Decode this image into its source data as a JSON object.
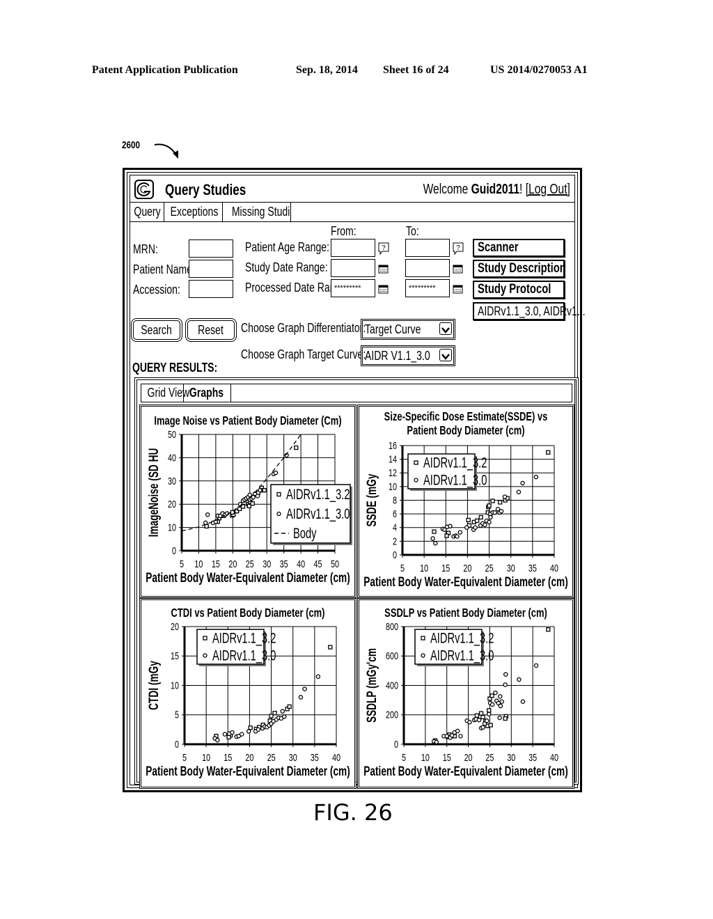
{
  "header": {
    "publication": "Patent Application Publication",
    "date": "Sep. 18, 2014",
    "sheet": "Sheet 16 of 24",
    "number": "US 2014/0270053 A1"
  },
  "reference_label": "2600",
  "figure_caption": "FIG. 26",
  "app": {
    "title": "Query Studies",
    "welcome_prefix": "Welcome ",
    "username": "Guid2011",
    "welcome_suffix": "! ",
    "logout": "[Log Out]"
  },
  "nav_tabs": [
    {
      "label": "Query"
    },
    {
      "label": "Exceptions"
    },
    {
      "label": "Missing Studies"
    }
  ],
  "form": {
    "from_label": "From:",
    "to_label": "To:",
    "mrn_label": "MRN:",
    "mrn_value": "",
    "patient_name_label": "Patient Name:",
    "patient_name_value": "",
    "accession_label": "Accession:",
    "accession_value": "",
    "age_range_label": "Patient Age Range:",
    "age_from": "",
    "age_to": "",
    "study_date_label": "Study Date Range:",
    "study_from": "",
    "study_to": "",
    "processed_date_label": "Processed Date Range:",
    "processed_from": "*********",
    "processed_to": "*********",
    "filter_buttons": [
      "Scanner",
      "Study Description",
      "Study Protocol"
    ],
    "protocol_selection": "AIDRv1.1_3.0, AIDRv1...",
    "search_button": "Search",
    "reset_button": "Reset",
    "differentiator_label": "Choose Graph Differentiator:",
    "differentiator_value": "Target Curve",
    "target_curve_label": "Choose Graph Target Curve:",
    "target_curve_value": "AIDR V1.1_3.0"
  },
  "results": {
    "heading": "QUERY RESULTS:",
    "tabs": [
      {
        "label": "Grid View"
      },
      {
        "label": "Graphs",
        "active": true
      }
    ]
  },
  "chart_data": [
    {
      "type": "scatter",
      "title": "Image Noise vs Patient Body Diameter (Cm)",
      "xlabel": "Patient Body Water-Equivalent Diameter (cm)",
      "ylabel": "ImageNoise (SD HU",
      "xlim": [
        5,
        50
      ],
      "ylim": [
        0,
        50
      ],
      "xticks": [
        5,
        10,
        15,
        20,
        25,
        30,
        35,
        40,
        45,
        50
      ],
      "yticks": [
        0,
        10,
        20,
        30,
        40,
        50
      ],
      "grid": true,
      "legend": "bottom-right",
      "series": [
        {
          "name": "AIDRv1.1_3.2",
          "marker": "square",
          "points": [
            [
              12.3,
              10.5
            ],
            [
              15.6,
              12.5
            ],
            [
              16,
              14
            ],
            [
              17.3,
              15
            ],
            [
              19.8,
              15.2
            ],
            [
              20.2,
              15.5
            ],
            [
              19.9,
              16.5
            ],
            [
              21.2,
              17
            ],
            [
              22,
              18
            ],
            [
              23,
              19
            ],
            [
              24.5,
              20
            ],
            [
              24.8,
              19.2
            ],
            [
              25.1,
              21
            ],
            [
              25.8,
              20.3
            ],
            [
              27.5,
              25
            ],
            [
              28.5,
              27
            ],
            [
              28.8,
              26
            ],
            [
              29.3,
              26
            ],
            [
              38.6,
              44.3
            ]
          ]
        },
        {
          "name": "AIDRv1.1_3.0",
          "marker": "circle",
          "points": [
            [
              12,
              12
            ],
            [
              12.6,
              15.5
            ],
            [
              14.2,
              12
            ],
            [
              15,
              12.5
            ],
            [
              15.6,
              15
            ],
            [
              16.3,
              15
            ],
            [
              17,
              16
            ],
            [
              17.8,
              15.5
            ],
            [
              18.3,
              16
            ],
            [
              22.2,
              20
            ],
            [
              23,
              21.5
            ],
            [
              23.5,
              22
            ],
            [
              24,
              22.5
            ],
            [
              24.5,
              23
            ],
            [
              25,
              24
            ],
            [
              25,
              22
            ],
            [
              25.5,
              22.5
            ],
            [
              26,
              23
            ],
            [
              26.5,
              24.5
            ],
            [
              27.3,
              23.5
            ],
            [
              28,
              26
            ],
            [
              32,
              33
            ],
            [
              32.6,
              33.5
            ],
            [
              35.8,
              41
            ]
          ]
        },
        {
          "name": "Body",
          "style": "dashed",
          "line": [
            [
              5,
              8.5
            ],
            [
              10,
              10.2
            ],
            [
              15,
              13
            ],
            [
              20,
              17
            ],
            [
              25,
              22.5
            ],
            [
              30,
              31
            ],
            [
              35,
              40
            ],
            [
              40,
              51
            ]
          ]
        }
      ]
    },
    {
      "type": "scatter",
      "title": "Size-Specific Dose Estimate(SSDE) vs Patient Body Diameter (cm)",
      "title_lines": [
        "Size-Specific Dose Estimate(SSDE) vs",
        "Patient Body Diameter (cm)"
      ],
      "xlabel": "Patient Body Water-Equivalent Diameter (cm)",
      "ylabel": "SSDE (mGy",
      "xlim": [
        5,
        40
      ],
      "ylim": [
        0,
        16
      ],
      "xticks": [
        5,
        10,
        15,
        20,
        25,
        30,
        35,
        40
      ],
      "yticks": [
        0,
        2,
        4,
        6,
        8,
        10,
        12,
        14,
        16
      ],
      "grid": true,
      "legend": "top-left",
      "series": [
        {
          "name": "AIDRv1.1_3.2",
          "marker": "square",
          "points": [
            [
              12.3,
              3.4
            ],
            [
              15.6,
              3.2
            ],
            [
              15.2,
              2.8
            ],
            [
              20.2,
              5.1
            ],
            [
              20.4,
              4.3
            ],
            [
              21.5,
              4.8
            ],
            [
              22.2,
              5
            ],
            [
              23.1,
              5.5
            ],
            [
              24.7,
              6.2
            ],
            [
              24.8,
              7
            ],
            [
              25,
              7.2
            ],
            [
              25.8,
              7.9
            ],
            [
              25.3,
              6
            ],
            [
              27.5,
              7.7
            ],
            [
              28.7,
              8
            ],
            [
              29.2,
              8.3
            ],
            [
              38.6,
              15
            ]
          ]
        },
        {
          "name": "AIDRv1.1_3.0",
          "marker": "circle",
          "points": [
            [
              12,
              2.4
            ],
            [
              12.6,
              1.7
            ],
            [
              14.3,
              3.8
            ],
            [
              14.7,
              3.7
            ],
            [
              15.3,
              4.1
            ],
            [
              16,
              4.2
            ],
            [
              16.8,
              2.7
            ],
            [
              17.3,
              2.8
            ],
            [
              17.6,
              2.7
            ],
            [
              18.3,
              3.3
            ],
            [
              19.8,
              4
            ],
            [
              21.4,
              3.7
            ],
            [
              21.8,
              4
            ],
            [
              23,
              4.3
            ],
            [
              23.5,
              4.6
            ],
            [
              24,
              4.4
            ],
            [
              24.4,
              5
            ],
            [
              25,
              4.8
            ],
            [
              25.3,
              5.5
            ],
            [
              25.8,
              6.2
            ],
            [
              26.3,
              6.2
            ],
            [
              27,
              6.7
            ],
            [
              27.4,
              6.2
            ],
            [
              27.8,
              6.4
            ],
            [
              28.6,
              8.5
            ],
            [
              31.8,
              9.2
            ],
            [
              32.7,
              10.5
            ],
            [
              35.8,
              11.4
            ]
          ]
        }
      ]
    },
    {
      "type": "scatter",
      "title": "CTDI vs Patient Body Diameter (cm)",
      "xlabel": "Patient Body Water-Equivalent Diameter (cm)",
      "ylabel": "CTDI (mGy",
      "xlim": [
        5,
        40
      ],
      "ylim": [
        0,
        20
      ],
      "xticks": [
        5,
        10,
        15,
        20,
        25,
        30,
        35,
        40
      ],
      "yticks": [
        0,
        5,
        10,
        15,
        20
      ],
      "grid": true,
      "legend": "top-left",
      "series": [
        {
          "name": "AIDRv1.1_3.2",
          "marker": "square",
          "points": [
            [
              12.3,
              1.4
            ],
            [
              15.6,
              1.5
            ],
            [
              15.2,
              1.2
            ],
            [
              20.2,
              2.8
            ],
            [
              21.5,
              2.6
            ],
            [
              22.2,
              2.9
            ],
            [
              23.1,
              3.3
            ],
            [
              24.7,
              4
            ],
            [
              25,
              4.8
            ],
            [
              25.8,
              5.3
            ],
            [
              28.7,
              6
            ],
            [
              29.2,
              6.4
            ],
            [
              38.6,
              16.5
            ]
          ]
        },
        {
          "name": "AIDRv1.1_3.0",
          "marker": "circle",
          "points": [
            [
              12,
              1
            ],
            [
              12.6,
              0.7
            ],
            [
              14.3,
              1.7
            ],
            [
              15.3,
              1.8
            ],
            [
              16,
              2
            ],
            [
              17,
              1.3
            ],
            [
              17.5,
              1.4
            ],
            [
              18.2,
              1.7
            ],
            [
              19.8,
              2.2
            ],
            [
              21.4,
              2.2
            ],
            [
              22,
              2.5
            ],
            [
              23,
              2.7
            ],
            [
              23.5,
              3
            ],
            [
              24,
              2.9
            ],
            [
              24.5,
              3.2
            ],
            [
              25,
              3.5
            ],
            [
              25.5,
              3.9
            ],
            [
              26.2,
              4.2
            ],
            [
              26.7,
              4.5
            ],
            [
              27.3,
              4.4
            ],
            [
              27.6,
              5.6
            ],
            [
              28,
              4.7
            ],
            [
              31.8,
              8
            ],
            [
              32.7,
              9.4
            ],
            [
              35.8,
              11.5
            ]
          ]
        }
      ]
    },
    {
      "type": "scatter",
      "title": "SSDLP vs Patient Body Diameter (cm)",
      "xlabel": "Patient Body Water-Equivalent Diameter (cm)",
      "ylabel": "SSDLP (mGy'cm",
      "xlim": [
        5,
        40
      ],
      "ylim": [
        0,
        800
      ],
      "xticks": [
        5,
        10,
        15,
        20,
        25,
        30,
        35,
        40
      ],
      "yticks": [
        0,
        200,
        400,
        600,
        800
      ],
      "grid": true,
      "legend": "top-left",
      "series": [
        {
          "name": "AIDRv1.1_3.2",
          "marker": "square",
          "points": [
            [
              12.3,
              25
            ],
            [
              15.6,
              65
            ],
            [
              15.2,
              50
            ],
            [
              16.8,
              55
            ],
            [
              22,
              195
            ],
            [
              23,
              210
            ],
            [
              23.4,
              185
            ],
            [
              24,
              160
            ],
            [
              24.5,
              125
            ],
            [
              25,
              310
            ],
            [
              25.5,
              330
            ],
            [
              24.8,
              230
            ],
            [
              25.2,
              130
            ],
            [
              28.8,
              190
            ],
            [
              28.6,
              175
            ],
            [
              38.6,
              780
            ]
          ]
        },
        {
          "name": "AIDRv1.1_3.0",
          "marker": "circle",
          "points": [
            [
              12,
              20
            ],
            [
              12.6,
              15
            ],
            [
              14.3,
              55
            ],
            [
              15,
              55
            ],
            [
              15.8,
              45
            ],
            [
              16.2,
              60
            ],
            [
              16.8,
              80
            ],
            [
              17.5,
              90
            ],
            [
              18.2,
              55
            ],
            [
              19.7,
              160
            ],
            [
              20.3,
              150
            ],
            [
              21.4,
              165
            ],
            [
              21.8,
              170
            ],
            [
              22.5,
              165
            ],
            [
              23,
              110
            ],
            [
              23.4,
              115
            ],
            [
              23.8,
              140
            ],
            [
              24.3,
              160
            ],
            [
              24.8,
              205
            ],
            [
              25.1,
              280
            ],
            [
              25.6,
              270
            ],
            [
              26.3,
              350
            ],
            [
              26.6,
              295
            ],
            [
              27,
              280
            ],
            [
              27.3,
              180
            ],
            [
              27.5,
              260
            ],
            [
              27.8,
              290
            ],
            [
              27.4,
              325
            ],
            [
              28.6,
              405
            ],
            [
              28.7,
              475
            ],
            [
              31.8,
              440
            ],
            [
              32.7,
              290
            ],
            [
              35.8,
              535
            ]
          ]
        }
      ]
    }
  ]
}
